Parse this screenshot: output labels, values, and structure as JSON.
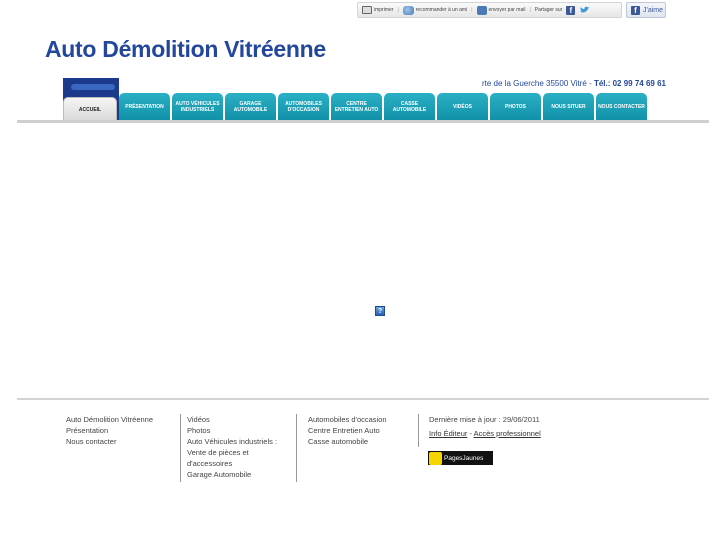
{
  "toolbar": {
    "print_label": "imprimer",
    "recommend_label": "recommander à un ami",
    "email_label": "envoyer par mail",
    "share_label": "Partager sur",
    "like_label": "J'aime"
  },
  "site": {
    "title": "Auto Démolition Vitréenne",
    "address": "rte de la Guerche 35500 Vitré",
    "phone_label": "Tél.: 02 99 74 69 61"
  },
  "nav": {
    "items": [
      {
        "label": "ACCUEIL"
      },
      {
        "label": "PRÉSENTATION"
      },
      {
        "label": "AUTO VÉHICULES INDUSTRIELS"
      },
      {
        "label": "GARAGE AUTOMOBILE"
      },
      {
        "label": "AUTOMOBILES D'OCCASION"
      },
      {
        "label": "CENTRE ENTRETIEN AUTO"
      },
      {
        "label": "CASSE AUTOMOBILE"
      },
      {
        "label": "VIDÉOS"
      },
      {
        "label": "PHOTOS"
      },
      {
        "label": "NOUS SITUER"
      },
      {
        "label": "NOUS CONTACTER"
      }
    ]
  },
  "footer": {
    "col1": [
      "Auto Démolition Vitréenne",
      "Présentation",
      "Nous contacter"
    ],
    "col2": [
      "Vidéos",
      "Photos",
      "Auto Véhicules industriels :",
      "Vente de pièces et",
      "d'accessoires",
      "Garage Automobile"
    ],
    "col3": [
      "Automobiles d'occasion",
      "Centre Entretien Auto",
      "Casse automobile"
    ],
    "last_update": "Dernière mise à jour : 29/06/2011",
    "info_editeur": "Info Éditeur",
    "dash": " - ",
    "acces_pro": "Accès professionnel",
    "pages_jaunes": "PagesJaunes"
  },
  "colors": {
    "title": "#23479c",
    "tab": "#1ba3b9"
  }
}
